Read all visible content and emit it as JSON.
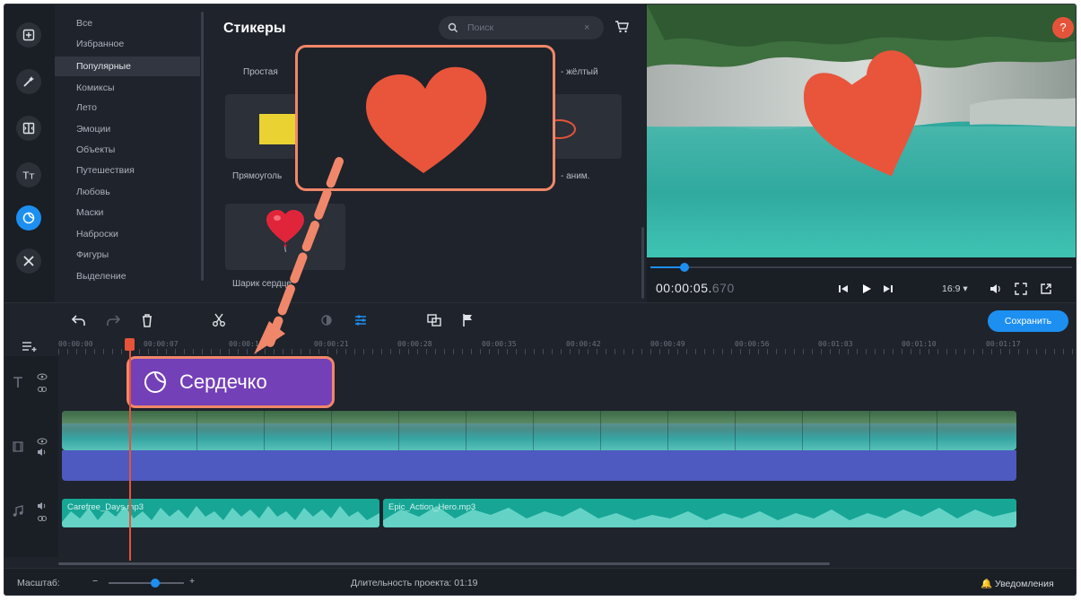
{
  "categories": [
    {
      "label": "Все",
      "selected": false
    },
    {
      "label": "Избранное",
      "selected": false
    },
    {
      "label": "Популярные",
      "selected": true
    },
    {
      "label": "Комиксы",
      "selected": false
    },
    {
      "label": "Лето",
      "selected": false
    },
    {
      "label": "Эмоции",
      "selected": false
    },
    {
      "label": "Объекты",
      "selected": false
    },
    {
      "label": "Путешествия",
      "selected": false
    },
    {
      "label": "Любовь",
      "selected": false
    },
    {
      "label": "Маски",
      "selected": false
    },
    {
      "label": "Наброски",
      "selected": false
    },
    {
      "label": "Фигуры",
      "selected": false
    },
    {
      "label": "Выделение",
      "selected": false
    }
  ],
  "stickers": {
    "title": "Стикеры",
    "search_placeholder": "Поиск",
    "search_clear": "×",
    "row1_left_partial": "Простая",
    "row1_right_partial": "- жёлтый",
    "tile_left_label": "Прямоуголь",
    "tile_right_label": "- аним.",
    "tile_heart_balloon_label": "Шарик сердце"
  },
  "preview": {
    "help": "?",
    "timecode_main": "00:00:05.",
    "timecode_ms": "670",
    "aspect_ratio": "16:9",
    "aspect_chevron": "▾",
    "seek_progress": 0.08
  },
  "toolbar": {
    "save_label": "Сохранить"
  },
  "ruler": {
    "labels": [
      "00:00:00",
      "00:00:07",
      "00:00:14",
      "00:00:21",
      "00:00:28",
      "00:00:35",
      "00:00:42",
      "00:00:49",
      "00:00:56",
      "00:01:03",
      "00:01:10",
      "00:01:17"
    ]
  },
  "timeline": {
    "sticker_clip_label": "Сердечко",
    "audio_clips": [
      {
        "name": "Carefree_Days.mp3"
      },
      {
        "name": "Epic_Action_Hero.mp3"
      }
    ]
  },
  "status": {
    "zoom_label": "Масштаб:",
    "zoom_minus": "−",
    "zoom_plus": "+",
    "zoom_level": 0.62,
    "duration_label": "Длительность проекта: 01:19",
    "notifications_label": "Уведомления"
  },
  "colors": {
    "accent": "#1d8ff1",
    "highlight_border": "#f0876a",
    "heart": "#e8553b",
    "sticker_clip": "#7440b8",
    "audio_clip": "#17a596",
    "video_audio": "#4e5ac0"
  },
  "icons": {
    "sidebar": [
      "import-icon",
      "effects-wand-icon",
      "transitions-icon",
      "titles-icon",
      "stickers-icon",
      "tools-icon"
    ],
    "toolbar": [
      "undo-icon",
      "redo-icon",
      "delete-icon",
      "cut-icon",
      "color-adjust-icon",
      "clip-properties-icon",
      "overlay-icon",
      "marker-flag-icon"
    ]
  }
}
